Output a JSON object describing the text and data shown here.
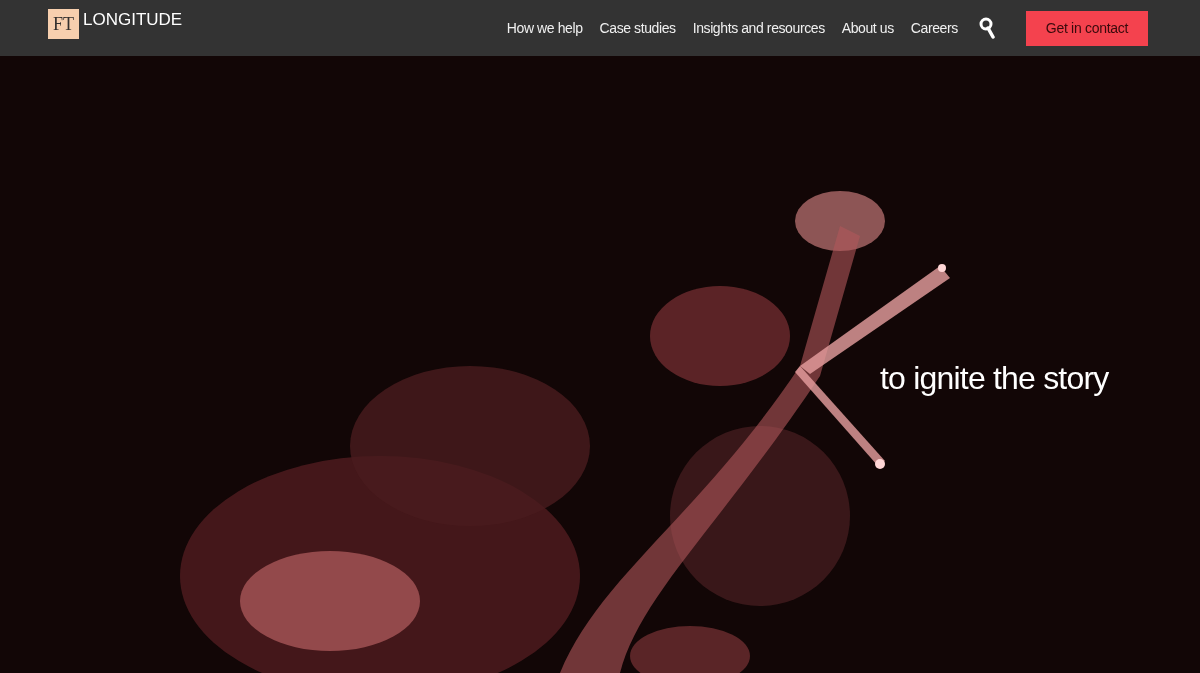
{
  "header": {
    "logo": {
      "mark": "FT",
      "name": "LONGITUDE"
    },
    "nav": [
      {
        "label": "How we help"
      },
      {
        "label": "Case studies"
      },
      {
        "label": "Insights and resources"
      },
      {
        "label": "About us"
      },
      {
        "label": "Careers"
      }
    ],
    "cta": "Get in contact"
  },
  "hero": {
    "kind": "picture",
    "caption": "to ignite the story"
  }
}
